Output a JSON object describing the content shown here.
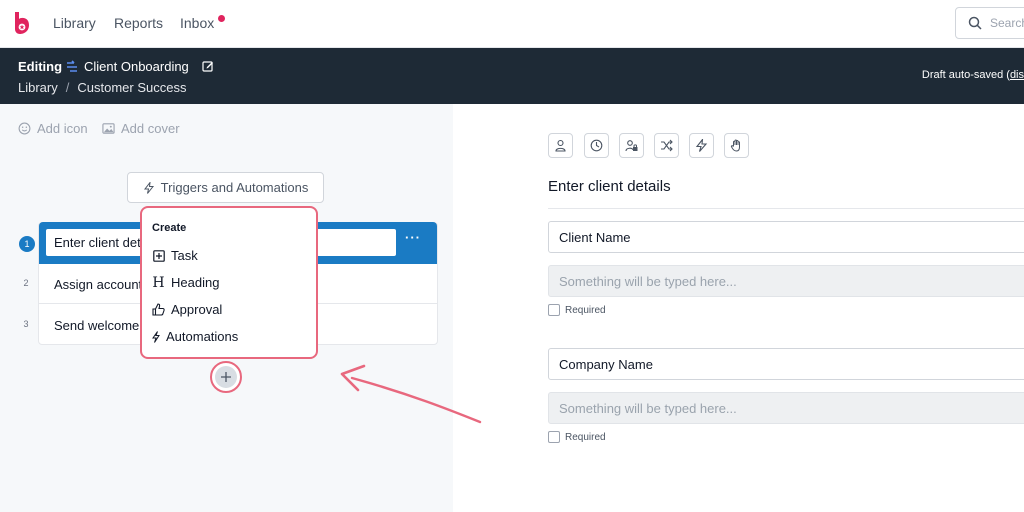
{
  "nav": {
    "links": [
      "Library",
      "Reports",
      "Inbox"
    ],
    "search_placeholder": "Search"
  },
  "header": {
    "mode": "Editing",
    "title": "Client Onboarding",
    "breadcrumb": [
      "Library",
      "Customer Success"
    ],
    "autosave_text": "Draft auto-saved (",
    "autosave_link": "dis"
  },
  "left": {
    "add_icon": "Add icon",
    "add_cover": "Add cover",
    "triggers_button": "Triggers and Automations",
    "steps": [
      {
        "num": "1",
        "text": "Enter client details"
      },
      {
        "num": "2",
        "text": "Assign account manager"
      },
      {
        "num": "3",
        "text": "Send welcome email"
      }
    ],
    "more_label": "···",
    "popup": {
      "title": "Create",
      "items": [
        "Task",
        "Heading",
        "Approval",
        "Automations"
      ]
    }
  },
  "right": {
    "step_title": "Enter client details",
    "fields": [
      {
        "label": "Client Name",
        "placeholder": "Something will be typed here...",
        "required_label": "Required"
      },
      {
        "label": "Company Name",
        "placeholder": "Something will be typed here...",
        "required_label": "Required"
      }
    ]
  },
  "colors": {
    "accent": "#1a7bc4",
    "header_bg": "#1e2a36",
    "highlight": "#e8687e",
    "brand": "#e0245e"
  }
}
